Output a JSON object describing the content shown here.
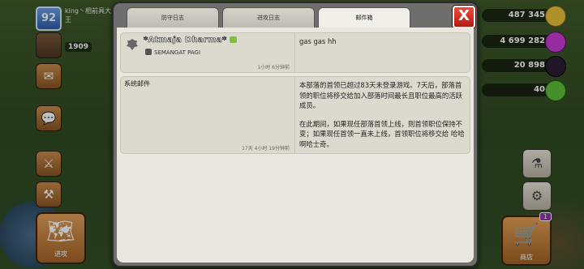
{
  "player": {
    "level": "92",
    "name": "king丶相前具大王"
  },
  "trophies": "1909",
  "resources": [
    {
      "name": "gold",
      "value": "487 345",
      "color": "#e8c23a"
    },
    {
      "name": "elixir",
      "value": "4 699 282",
      "color": "#c93ad8"
    },
    {
      "name": "dark-elixir",
      "value": "20 898",
      "color": "#2a1f33"
    },
    {
      "name": "gems",
      "value": "40",
      "color": "#5fbf3a"
    }
  ],
  "buttons": {
    "attack_label": "进攻",
    "shop_label": "商店",
    "shop_badge": "1"
  },
  "tabs": [
    "防守日志",
    "进攻日志",
    "邮件箱"
  ],
  "close_label": "X",
  "messages": [
    {
      "sender": "*Atmaja Dharma*",
      "clan": "SEMANGAT PAGI",
      "time": "1小时 6分钟前",
      "body": "gas gas hh"
    },
    {
      "sender": "系统邮件",
      "time": "17天 4小时 19分钟前",
      "para1": "本部落的首领已超过83天未登录游戏。7天后，部落首领的职位将移交给加入部落时间最长且职位最高的活跃成员。",
      "para2": "在此期间，如果现任部落首领上线，则首领职位保持不变；如果现任首领一直未上线，首领职位将移交给 哈哈啊哈士奇。"
    }
  ]
}
